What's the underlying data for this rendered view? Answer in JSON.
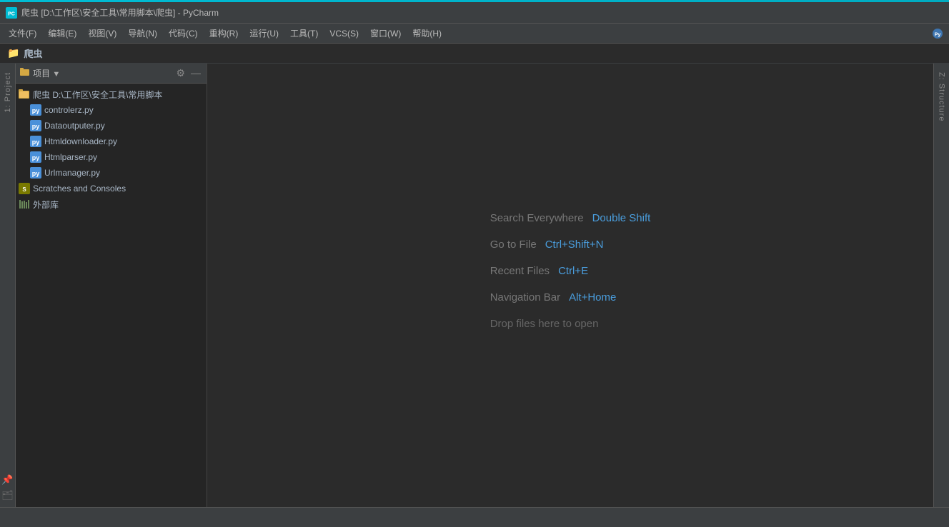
{
  "window": {
    "title": "爬虫 [D:\\工作区\\安全工具\\常用脚本\\爬虫] - PyCharm",
    "accent_color": "#00bcd4"
  },
  "title_bar": {
    "icon_label": "PC",
    "title": "爬虫 [D:\\工作区\\安全工具\\常用脚本\\爬虫] - PyCharm"
  },
  "menu_bar": {
    "items": [
      {
        "label": "文件(F)"
      },
      {
        "label": "编辑(E)"
      },
      {
        "label": "视图(V)"
      },
      {
        "label": "导航(N)"
      },
      {
        "label": "代码(C)"
      },
      {
        "label": "重构(R)"
      },
      {
        "label": "运行(U)"
      },
      {
        "label": "工具(T)"
      },
      {
        "label": "VCS(S)"
      },
      {
        "label": "窗口(W)"
      },
      {
        "label": "帮助(H)"
      }
    ]
  },
  "breadcrumb": {
    "text": "爬虫"
  },
  "sidebar": {
    "header": {
      "title": "项目",
      "settings_icon": "⚙",
      "minimize_icon": "—"
    },
    "tree": {
      "root": {
        "label": "爬虫 D:\\工作区\\安全工具\\常用脚本",
        "children": [
          {
            "label": "controlerz.py"
          },
          {
            "label": "Dataoutputer.py"
          },
          {
            "label": "Htmldownloader.py"
          },
          {
            "label": "Htmlparser.py"
          },
          {
            "label": "Urlmanager.py"
          }
        ]
      },
      "scratches": {
        "label": "Scratches and Consoles"
      },
      "external_lib": {
        "label": "外部库"
      }
    }
  },
  "left_strip": {
    "label": "1: Project"
  },
  "right_strip": {
    "label": "Z: Structure"
  },
  "welcome": {
    "shortcuts": [
      {
        "label": "Search Everywhere",
        "key": "Double Shift"
      },
      {
        "label": "Go to File",
        "key": "Ctrl+Shift+N"
      },
      {
        "label": "Recent Files",
        "key": "Ctrl+E"
      },
      {
        "label": "Navigation Bar",
        "key": "Alt+Home"
      }
    ],
    "drop_label": "Drop files here to open"
  }
}
